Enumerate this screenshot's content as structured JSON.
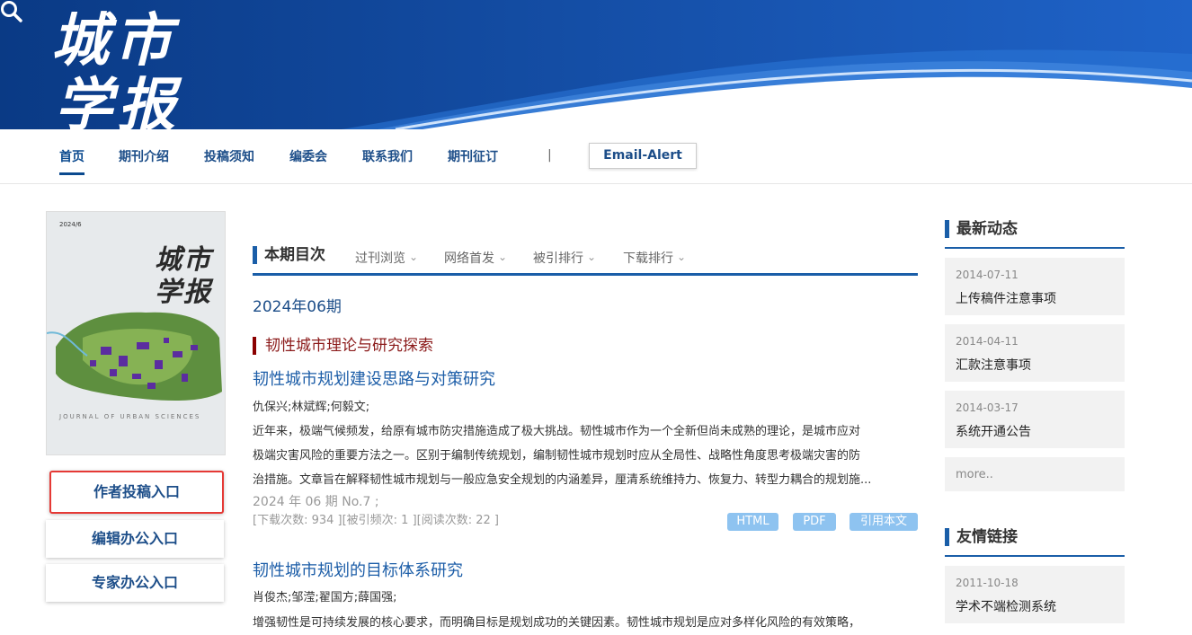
{
  "header": {
    "logo_line1": "城市",
    "logo_line2": "学报",
    "search_icon": "search-icon"
  },
  "nav": {
    "items": [
      "首页",
      "期刊介绍",
      "投稿须知",
      "编委会",
      "联系我们",
      "期刊征订"
    ],
    "separator": "|",
    "email_alert": "Email-Alert"
  },
  "cover": {
    "issue": "2024/6",
    "title": "城市学报",
    "journal_en": "JOURNAL OF URBAN SCIENCES"
  },
  "sidebar": {
    "buttons": [
      "作者投稿入口",
      "编辑办公入口",
      "专家办公入口"
    ]
  },
  "toc": {
    "heading": "本期目次",
    "tabs": [
      "过刊浏览",
      "网络首发",
      "被引排行",
      "下载排行"
    ],
    "issue_date": "2024年06期",
    "section": "韧性城市理论与研究探索",
    "articles": [
      {
        "title": "韧性城市规划建设思路与对策研究",
        "authors": "仇保兴;林斌辉;何毅文;",
        "abstract_lines": [
          "近年来，极端气候频发，给原有城市防灾措施造成了极大挑战。韧性城市作为一个全新但尚未成熟的理论，是城市应对",
          "极端灾害风险的重要方法之一。区别于编制传统规划，编制韧性城市规划时应从全局性、战略性角度思考极端灾害的防",
          "治措施。文章旨在解释韧性城市规划与一般应急安全规划的内涵差异，厘清系统维持力、恢复力、转型力耦合的规划施..."
        ],
        "meta": "2024 年 06 期 No.7 ;",
        "counts": "[下载次数:  934 ][被引频次:  1 ][阅读次数:  22 ]",
        "buttons": [
          "HTML",
          "PDF",
          "引用本文"
        ]
      },
      {
        "title": "韧性城市规划的目标体系研究",
        "authors": "肖俊杰;邹滢;翟国方;薛国强;",
        "abstract_lines": [
          "增强韧性是可持续发展的核心要求，而明确目标是规划成功的关键因素。韧性城市规划是应对多样化风险的有效策略，"
        ]
      }
    ]
  },
  "news": {
    "heading": "最新动态",
    "items": [
      {
        "date": "2014-07-11",
        "title": "上传稿件注意事项"
      },
      {
        "date": "2014-04-11",
        "title": "汇款注意事项"
      },
      {
        "date": "2014-03-17",
        "title": "系统开通公告"
      }
    ],
    "more": "more.."
  },
  "links": {
    "heading": "友情链接",
    "items": [
      {
        "date": "2011-10-18",
        "title": "学术不端检测系统"
      }
    ]
  },
  "colors": {
    "banner": "#0b3f8f",
    "accent": "#1a5ea8",
    "section": "#8b0000",
    "pill": "#8ec3f0"
  }
}
